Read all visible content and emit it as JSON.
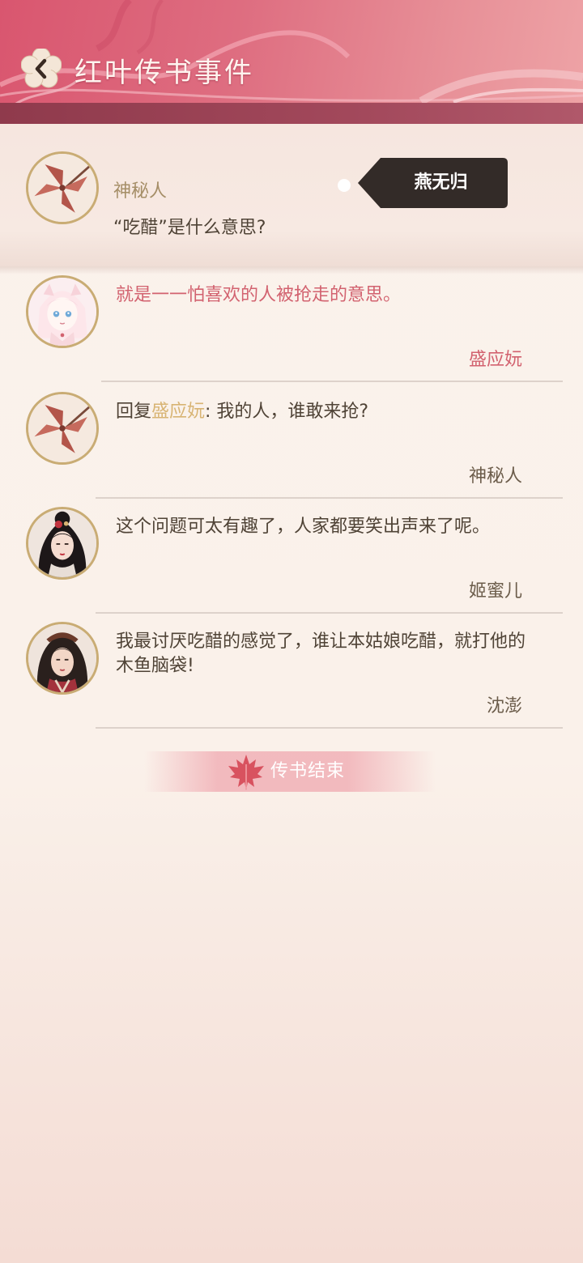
{
  "header": {
    "title": "红叶传书事件",
    "back_icon": "back-flower-icon"
  },
  "post": {
    "author": "神秘人",
    "question": "“吃醋”是什么意思?",
    "tag_label": "燕无归",
    "avatar_icon": "pinwheel-avatar"
  },
  "replies": [
    {
      "text": "就是一一怕喜欢的人被抢走的意思。",
      "signature": "盛应妧",
      "avatar": "anime-girl-avatar"
    },
    {
      "prefix": "回复",
      "mention": "盛应妧",
      "text": ": 我的人，谁敢来抢?",
      "signature": "神秘人",
      "avatar": "pinwheel-avatar"
    },
    {
      "text": "这个问题可太有趣了，人家都要笑出声来了呢。",
      "signature": "姬蜜儿",
      "avatar": "lady-portrait-avatar"
    },
    {
      "text": "我最讨厌吃醋的感觉了，谁让本姑娘吃醋，就打他的木鱼脑袋!",
      "signature": "沈澎",
      "avatar": "warrior-portrait-avatar"
    }
  ],
  "footer": {
    "end_label": "传书结束",
    "icon": "maple-leaf-icon"
  },
  "colors": {
    "header_pink": "#d9566f",
    "accent_pink": "#d2626f",
    "gold": "#d8b473",
    "text": "#4f4336"
  }
}
